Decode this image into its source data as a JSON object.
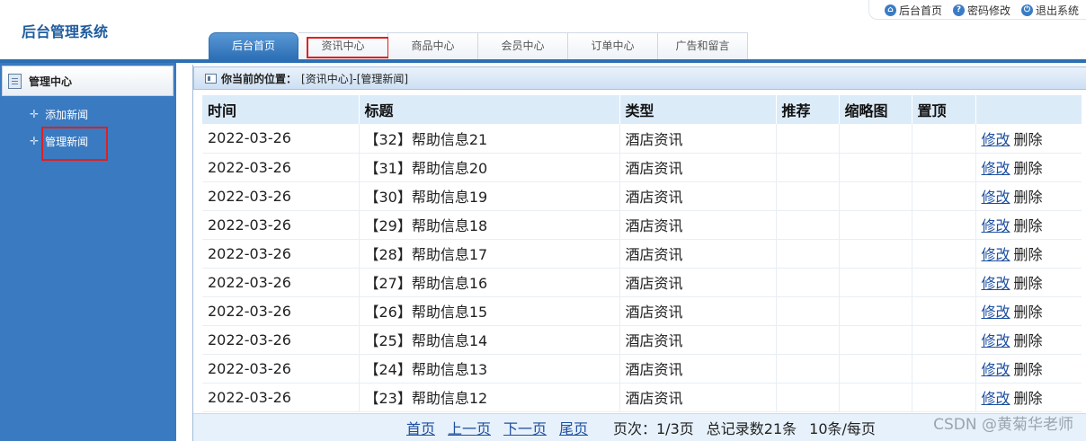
{
  "app": {
    "title": "后台管理系统"
  },
  "top_links": [
    {
      "label": "后台首页",
      "icon": "home-icon"
    },
    {
      "label": "密码修改",
      "icon": "help-icon"
    },
    {
      "label": "退出系统",
      "icon": "power-icon"
    }
  ],
  "nav_tabs": [
    {
      "label": "后台首页",
      "active": true
    },
    {
      "label": "资讯中心",
      "active": false,
      "highlighted": true
    },
    {
      "label": "商品中心",
      "active": false
    },
    {
      "label": "会员中心",
      "active": false
    },
    {
      "label": "订单中心",
      "active": false
    },
    {
      "label": "广告和留言",
      "active": false
    }
  ],
  "sidebar": {
    "header": "管理中心",
    "items": [
      {
        "label": "添加新闻"
      },
      {
        "label": "管理新闻",
        "highlighted": true
      }
    ]
  },
  "location": {
    "label": "你当前的位置：",
    "path": "[资讯中心]-[管理新闻]"
  },
  "table": {
    "columns": [
      "时间",
      "标题",
      "类型",
      "推荐",
      "缩略图",
      "置顶",
      ""
    ],
    "edit_label": "修改",
    "delete_label": "删除",
    "rows": [
      {
        "time": "2022-03-26",
        "title": "【32】帮助信息21",
        "type": "酒店资讯",
        "recommend": "",
        "thumb": "",
        "top": ""
      },
      {
        "time": "2022-03-26",
        "title": "【31】帮助信息20",
        "type": "酒店资讯",
        "recommend": "",
        "thumb": "",
        "top": ""
      },
      {
        "time": "2022-03-26",
        "title": "【30】帮助信息19",
        "type": "酒店资讯",
        "recommend": "",
        "thumb": "",
        "top": ""
      },
      {
        "time": "2022-03-26",
        "title": "【29】帮助信息18",
        "type": "酒店资讯",
        "recommend": "",
        "thumb": "",
        "top": ""
      },
      {
        "time": "2022-03-26",
        "title": "【28】帮助信息17",
        "type": "酒店资讯",
        "recommend": "",
        "thumb": "",
        "top": ""
      },
      {
        "time": "2022-03-26",
        "title": "【27】帮助信息16",
        "type": "酒店资讯",
        "recommend": "",
        "thumb": "",
        "top": ""
      },
      {
        "time": "2022-03-26",
        "title": "【26】帮助信息15",
        "type": "酒店资讯",
        "recommend": "",
        "thumb": "",
        "top": ""
      },
      {
        "time": "2022-03-26",
        "title": "【25】帮助信息14",
        "type": "酒店资讯",
        "recommend": "",
        "thumb": "",
        "top": ""
      },
      {
        "time": "2022-03-26",
        "title": "【24】帮助信息13",
        "type": "酒店资讯",
        "recommend": "",
        "thumb": "",
        "top": ""
      },
      {
        "time": "2022-03-26",
        "title": "【23】帮助信息12",
        "type": "酒店资讯",
        "recommend": "",
        "thumb": "",
        "top": ""
      }
    ]
  },
  "pager": {
    "first": "首页",
    "prev": "上一页",
    "next": "下一页",
    "last": "尾页",
    "page_info": "页次：1/3页",
    "total": "总记录数21条",
    "per_page": "10条/每页"
  },
  "watermark": "CSDN @黄菊华老师",
  "colors": {
    "primary": "#2c6fb4",
    "sidebar": "#3a7ac1",
    "highlight_border": "#e02020",
    "link": "#1d4fa0"
  }
}
